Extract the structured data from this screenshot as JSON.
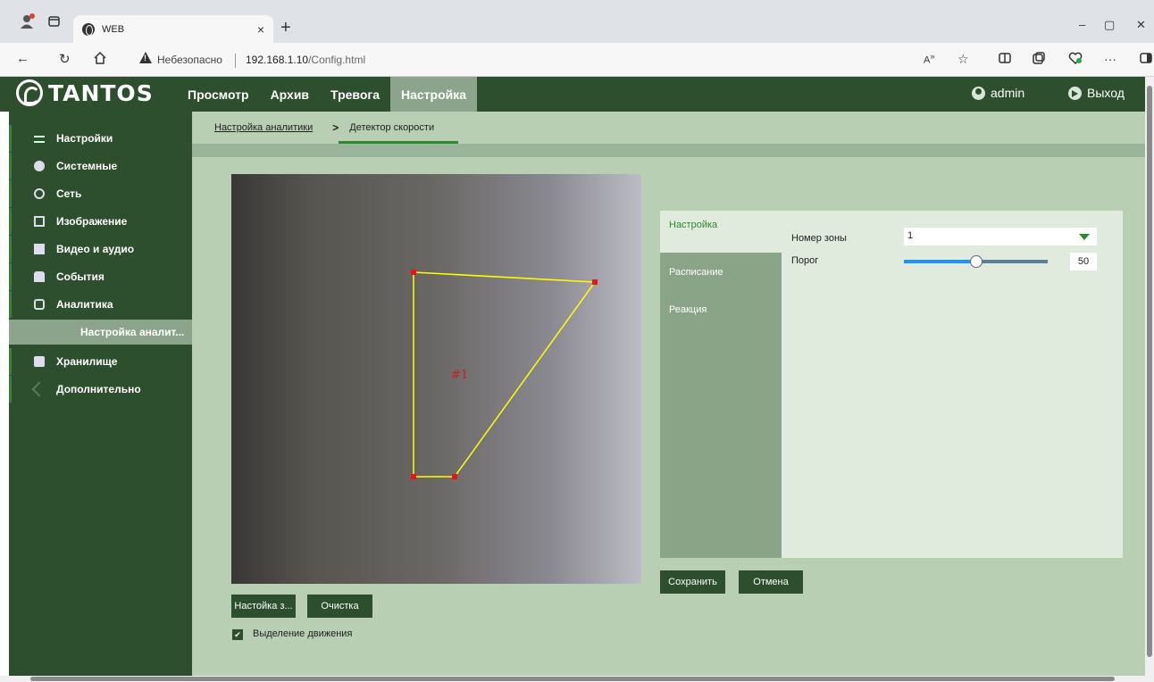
{
  "browser": {
    "tab_title": "WEB",
    "tab_close": "×",
    "new_tab": "+",
    "security_text": "Небезопасно",
    "url_host": "192.168.1.10",
    "url_path": "/Config.html",
    "more": "···",
    "minimize": "–",
    "maximize": "▢",
    "close": "✕"
  },
  "header": {
    "logo": "TANTOS",
    "nav": [
      "Просмотр",
      "Архив",
      "Тревога",
      "Настройка"
    ],
    "active_nav": "Настройка",
    "user": "admin",
    "logout": "Выход"
  },
  "sidebar": {
    "items": [
      {
        "label": "Настройки",
        "icon": "list-icon"
      },
      {
        "label": "Системные",
        "icon": "info-icon"
      },
      {
        "label": "Сеть",
        "icon": "globe-icon"
      },
      {
        "label": "Изображение",
        "icon": "image-icon"
      },
      {
        "label": "Видео и аудио",
        "icon": "video-icon"
      },
      {
        "label": "События",
        "icon": "event-icon"
      },
      {
        "label": "Аналитика",
        "icon": "analytics-icon"
      },
      {
        "label": "Настройка аналит...",
        "icon": "",
        "sub": true
      },
      {
        "label": "Хранилище",
        "icon": "storage-icon"
      },
      {
        "label": "Дополнительно",
        "icon": "tools-icon"
      }
    ]
  },
  "breadcrumb": {
    "parent": "Настройка аналитики",
    "separator": ">",
    "current": "Детектор скорости"
  },
  "video": {
    "zone_label": "#1"
  },
  "buttons": {
    "zone_setup": "Настойка з...",
    "clear": "Очистка",
    "save": "Сохранить",
    "cancel": "Отмена"
  },
  "motion": {
    "label": "Выделение движения",
    "checked": true
  },
  "panel": {
    "tabs": [
      "Настройка",
      "Расписание",
      "Реакция"
    ],
    "active_tab": "Настройка",
    "zone_number_label": "Номер зоны",
    "zone_number_value": "1",
    "threshold_label": "Порог",
    "threshold_value": "50",
    "threshold_fraction": 0.5
  },
  "colors": {
    "dark_green": "#2d4f2d",
    "main_bg": "#b8cfb4",
    "active_tab_text": "#2b8a2b",
    "zone_line": "#ffff00",
    "zone_vertex": "#e8141b"
  }
}
